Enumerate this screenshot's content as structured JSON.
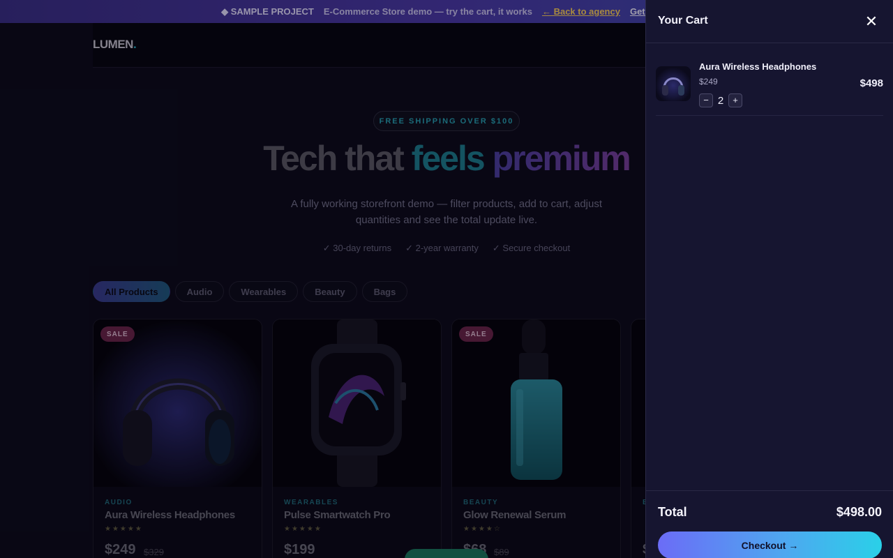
{
  "banner": {
    "project": "◆ SAMPLE PROJECT",
    "description": "E-Commerce Store demo — try the cart, it works",
    "back_link": "← Back to agency",
    "get_link": "Get this b"
  },
  "header": {
    "logo": "LUMEN",
    "logo_dot": "."
  },
  "hero": {
    "pill": "FREE SHIPPING OVER $100",
    "title_plain": "Tech that ",
    "title_accent1": "feels",
    "title_accent2": "premium",
    "subtitle": "A fully working storefront demo — filter products, add to cart, adjust quantities and see the total update live.",
    "perks": [
      "✓ 30-day returns",
      "✓ 2-year warranty",
      "✓ Secure checkout"
    ]
  },
  "filters": {
    "active": "All Products",
    "items": [
      "All Products",
      "Audio",
      "Wearables",
      "Beauty",
      "Bags"
    ]
  },
  "products": [
    {
      "badge": "SALE",
      "category": "AUDIO",
      "name": "Aura Wireless Headphones",
      "stars": "★★★★★",
      "price": "$249",
      "old_price": "$329",
      "rating": 5
    },
    {
      "badge": "",
      "category": "WEARABLES",
      "name": "Pulse Smartwatch Pro",
      "stars": "★★★★★",
      "price": "$199",
      "old_price": "",
      "rating": 5
    },
    {
      "badge": "SALE",
      "category": "BEAUTY",
      "name": "Glow Renewal Serum",
      "stars": "★★★★☆",
      "price": "$68",
      "old_price": "$89",
      "rating": 4
    },
    {
      "badge": "",
      "category": "B",
      "name": "",
      "stars": "",
      "price": "$",
      "old_price": ""
    }
  ],
  "cart": {
    "title": "Your Cart",
    "close_glyph": "✕",
    "items": [
      {
        "name": "Aura Wireless Headphones",
        "unit_price": "$249",
        "quantity": "2",
        "line_total": "$498",
        "minus": "−",
        "plus": "+"
      }
    ],
    "total_label": "Total",
    "total_value": "$498.00",
    "checkout_label": "Checkout →"
  },
  "colors": {
    "accent_teal": "#27a4b3",
    "accent_violet": "#6b6cf6",
    "sale_badge": "#6a2448",
    "drawer_bg": "#161530"
  }
}
